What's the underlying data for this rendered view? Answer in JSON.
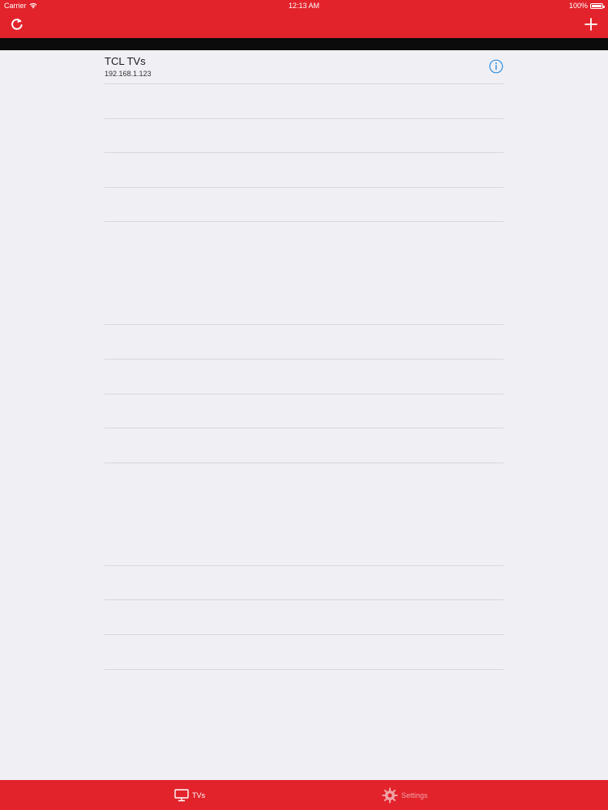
{
  "status_bar": {
    "carrier": "Carrier",
    "time": "12:13 AM",
    "battery": "100%"
  },
  "nav": {
    "refresh_icon": "refresh-icon",
    "add_icon": "plus-icon"
  },
  "tv_list": {
    "items": [
      {
        "name": "TCL TVs",
        "ip": "192.168.1.123"
      }
    ]
  },
  "tab_bar": {
    "tabs": [
      {
        "label": "TVs",
        "icon": "tv-icon",
        "active": true
      },
      {
        "label": "Settings",
        "icon": "gear-icon",
        "active": false
      }
    ]
  },
  "colors": {
    "accent": "#e2232b",
    "background": "#efeff4",
    "info_blue": "#2f8fe0"
  }
}
